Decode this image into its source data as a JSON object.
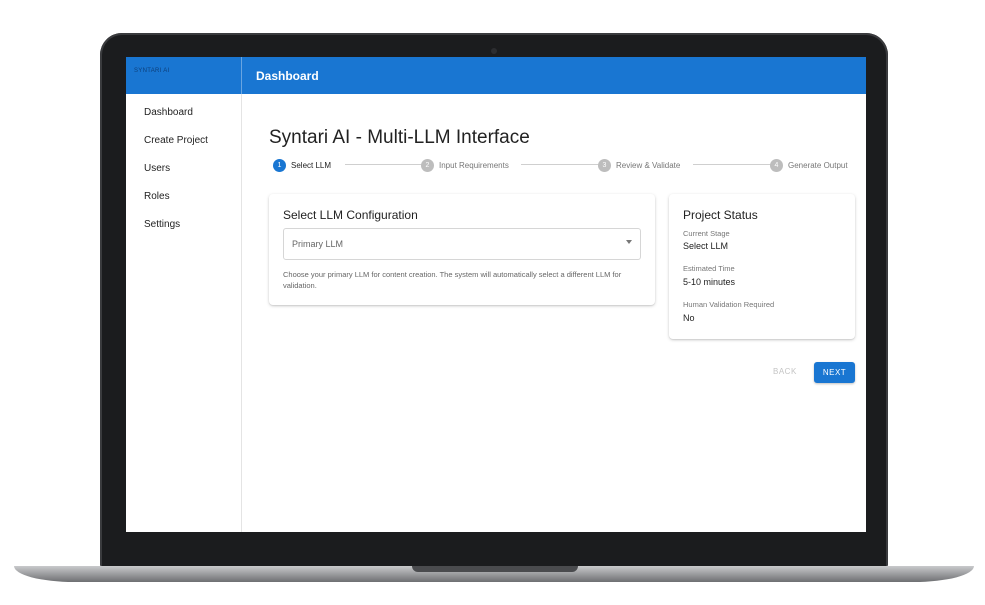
{
  "app": {
    "brand": "SYNTARI AI",
    "header_title": "Dashboard"
  },
  "sidebar": {
    "items": [
      {
        "label": "Dashboard"
      },
      {
        "label": "Create Project"
      },
      {
        "label": "Users"
      },
      {
        "label": "Roles"
      },
      {
        "label": "Settings"
      }
    ]
  },
  "main": {
    "title": "Syntari AI - Multi-LLM Interface",
    "steps": [
      {
        "num": "1",
        "label": "Select LLM",
        "active": true
      },
      {
        "num": "2",
        "label": "Input Requirements",
        "active": false
      },
      {
        "num": "3",
        "label": "Review & Validate",
        "active": false
      },
      {
        "num": "4",
        "label": "Generate Output",
        "active": false
      }
    ],
    "config": {
      "title": "Select LLM Configuration",
      "select_value": "Primary LLM",
      "helper": "Choose your primary LLM for content creation. The system will automatically select a different LLM for validation."
    },
    "status": {
      "title": "Project Status",
      "current_stage_label": "Current Stage",
      "current_stage_value": "Select LLM",
      "estimated_time_label": "Estimated Time",
      "estimated_time_value": "5-10 minutes",
      "validation_label": "Human Validation Required",
      "validation_value": "No"
    },
    "buttons": {
      "back": "BACK",
      "next": "NEXT"
    }
  },
  "colors": {
    "primary": "#1976d2",
    "frame": "#1b1c1e"
  }
}
